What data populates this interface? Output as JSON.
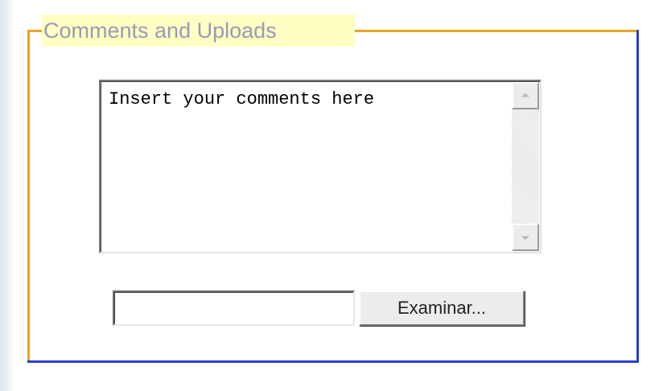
{
  "fieldset": {
    "legend": "Comments and Uploads",
    "border_color_top_left": "#e8a41b",
    "border_color_bottom_right": "#2d3fd3",
    "legend_background": "#ffffc4",
    "legend_color": "#9a9ab6"
  },
  "comments": {
    "value": "Insert your comments here",
    "scrollbar": {
      "up_icon": "arrow-up-icon",
      "down_icon": "arrow-down-icon"
    }
  },
  "upload": {
    "file_value": "",
    "browse_label": "Examinar..."
  }
}
